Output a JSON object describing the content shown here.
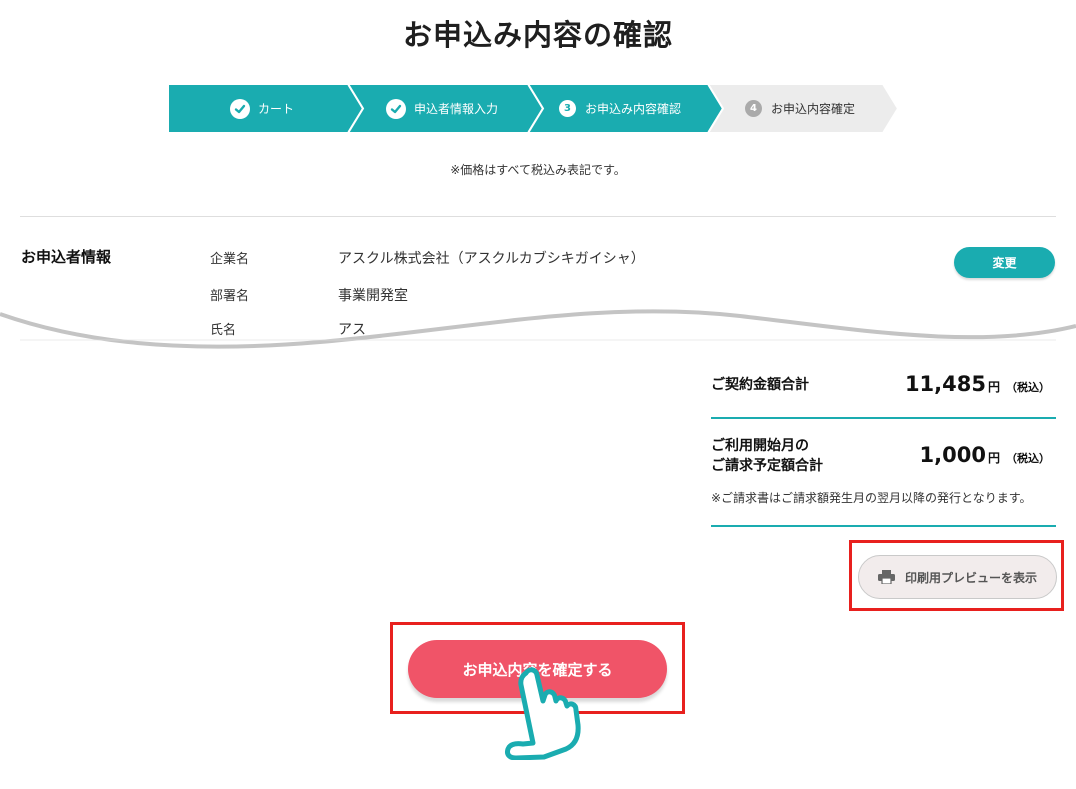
{
  "page": {
    "title": "お申込み内容の確認"
  },
  "stepper": {
    "steps": [
      {
        "label": "カート",
        "state": "done",
        "icon": "check-icon"
      },
      {
        "label": "申込者情報入力",
        "state": "done",
        "icon": "check-icon"
      },
      {
        "label": "お申込み内容確認",
        "state": "current",
        "number": "3"
      },
      {
        "label": "お申込内容確定",
        "state": "upcoming",
        "number": "4"
      }
    ]
  },
  "note": "※価格はすべて税込み表記です。",
  "applicant": {
    "section_label": "お申込者情報",
    "fields": [
      {
        "label": "企業名",
        "value": "アスクル株式会社（アスクルカブシキガイシャ）"
      },
      {
        "label": "部署名",
        "value": "事業開発室"
      },
      {
        "label": "氏名",
        "value": "アス"
      }
    ],
    "change_button": "変更"
  },
  "summary": {
    "contract_total_label": "ご契約金額合計",
    "contract_total_amount": "11,485",
    "yen": "円",
    "tax_included": "（税込）",
    "first_month_label_1": "ご利用開始月の",
    "first_month_label_2": "ご請求予定額合計",
    "first_month_amount": "1,000",
    "invoice_note": "※ご請求書はご請求額発生月の翌月以降の発行となります。"
  },
  "print_button": {
    "label": "印刷用プレビューを表示",
    "icon": "printer-icon"
  },
  "confirm_button": {
    "label": "お申込内容を確定する"
  },
  "colors": {
    "teal": "#1aacb0",
    "pink": "#f05468",
    "highlight": "#e8201e",
    "step_inactive": "#ececec"
  },
  "icons": {
    "pointer": "hand-pointer-icon"
  }
}
